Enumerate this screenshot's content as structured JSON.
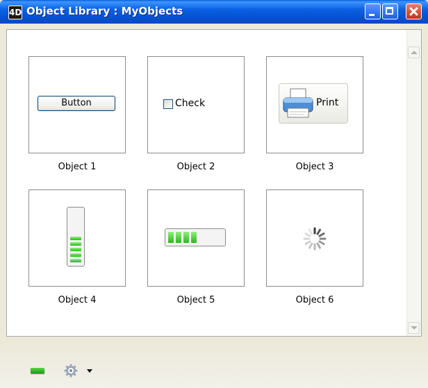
{
  "window": {
    "app_icon_glyph": "4D",
    "title": "Object Library : MyObjects"
  },
  "library": {
    "objects": [
      {
        "label": "Object 1",
        "preview_type": "button",
        "preview_text": "Button"
      },
      {
        "label": "Object 2",
        "preview_type": "checkbox",
        "preview_text": "Check"
      },
      {
        "label": "Object 3",
        "preview_type": "picture-button",
        "preview_text": "Print",
        "icon": "printer-icon"
      },
      {
        "label": "Object 4",
        "preview_type": "vertical-progress",
        "filled_segments": 5
      },
      {
        "label": "Object 5",
        "preview_type": "horizontal-progress",
        "filled_segments": 4
      },
      {
        "label": "Object 6",
        "preview_type": "spinner",
        "icon": "spinner-icon"
      }
    ]
  },
  "toolbar": {
    "remove_icon": "minus-icon",
    "actions_icon": "gear-icon",
    "actions_menu_icon": "chevron-down-icon"
  },
  "colors": {
    "titlebar": "#0a5fd8",
    "progress_green": "#2cb81a",
    "window_bg": "#ece9d8"
  }
}
